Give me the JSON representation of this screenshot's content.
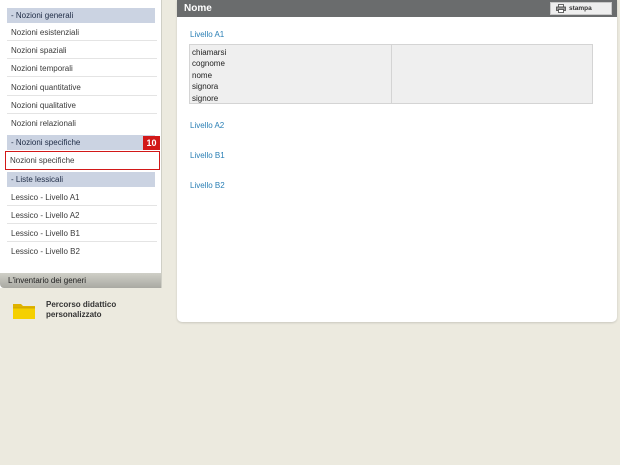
{
  "sidebar": {
    "sections": [
      {
        "title": "- Nozioni generali"
      },
      {
        "title": "- Nozioni specifiche"
      },
      {
        "title": "- Liste lessicali"
      }
    ],
    "generali_items": [
      "Nozioni esistenziali",
      "Nozioni spaziali",
      "Nozioni temporali",
      "Nozioni quantitative",
      "Nozioni qualitative",
      "Nozioni relazionali"
    ],
    "specifiche_items": [
      "Nozioni specifiche"
    ],
    "lessicali_items": [
      "Lessico - Livello A1",
      "Lessico - Livello A2",
      "Lessico - Livello B1",
      "Lessico - Livello B2"
    ],
    "badge": "10",
    "bottom_bar": "L'inventario dei generi",
    "course_label": "Percorso didattico personalizzato"
  },
  "main": {
    "title": "Nome",
    "print_label": "stampa",
    "levels": [
      "Livello A1",
      "Livello A2",
      "Livello B1",
      "Livello B2"
    ],
    "a1_words": [
      "chiamarsi",
      "cognome",
      "nome",
      "signora",
      "signore"
    ]
  },
  "colors": {
    "section_header": "#cbd3e2",
    "highlight": "#d21818",
    "link": "#2a7fb5",
    "main_header": "#6a6c6d"
  }
}
